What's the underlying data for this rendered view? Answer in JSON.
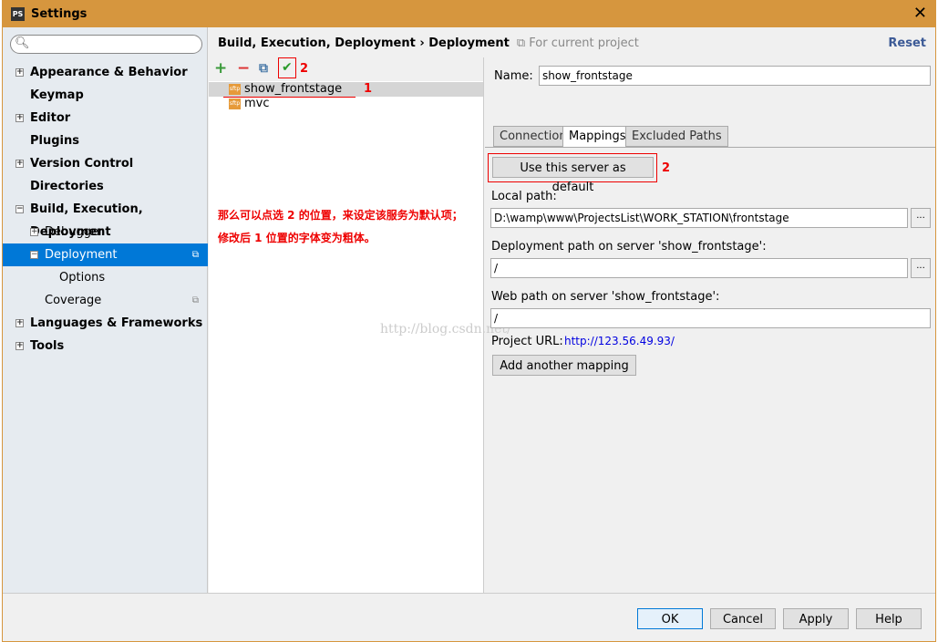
{
  "window": {
    "title": "Settings",
    "logo": "PS"
  },
  "sidebar": {
    "search_placeholder": "",
    "items": [
      {
        "label": "Appearance & Behavior",
        "bold": true,
        "toggle": "+"
      },
      {
        "label": "Keymap",
        "bold": true
      },
      {
        "label": "Editor",
        "bold": true,
        "toggle": "+"
      },
      {
        "label": "Plugins",
        "bold": true
      },
      {
        "label": "Version Control",
        "bold": true,
        "toggle": "+"
      },
      {
        "label": "Directories",
        "bold": true
      },
      {
        "label": "Build, Execution, Deployment",
        "bold": true,
        "toggle": "−"
      },
      {
        "label": "Debugger",
        "toggle": "+"
      },
      {
        "label": "Deployment",
        "toggle": "−",
        "selected": true
      },
      {
        "label": "Options"
      },
      {
        "label": "Coverage"
      },
      {
        "label": "Languages & Frameworks",
        "bold": true,
        "toggle": "+"
      },
      {
        "label": "Tools",
        "bold": true,
        "toggle": "+"
      }
    ]
  },
  "header": {
    "breadcrumb": "Build, Execution, Deployment › Deployment",
    "scope": "For current project",
    "reset": "Reset"
  },
  "servers": [
    {
      "name": "show_frontstage",
      "selected": true
    },
    {
      "name": "mvc"
    }
  ],
  "annotations": {
    "marker1": "1",
    "marker2": "2",
    "note_line1": "那么可以点选 2 的位置，来设定该服务为默认项；",
    "note_line2": "修改后 1 位置的字体变为粗体。",
    "watermark": "http://blog.csdn.net/"
  },
  "details": {
    "name_label": "Name:",
    "name_value": "show_frontstage",
    "tabs": [
      "Connection",
      "Mappings",
      "Excluded Paths"
    ],
    "active_tab": "Mappings",
    "default_button": "Use this server as default",
    "local_path_label": "Local path:",
    "local_path": "D:\\wamp\\www\\ProjectsList\\WORK_STATION\\frontstage",
    "deploy_path_label": "Deployment path on server 'show_frontstage':",
    "deploy_path": "/",
    "web_path_label": "Web path on server 'show_frontstage':",
    "web_path": "/",
    "project_url_label": "Project URL:",
    "project_url": "http://123.56.49.93/",
    "add_mapping": "Add another mapping",
    "browse": "..."
  },
  "footer": {
    "ok": "OK",
    "cancel": "Cancel",
    "apply": "Apply",
    "help": "Help"
  },
  "colors": {
    "titlebar": "#d6963e",
    "selection": "#0078d7",
    "annotation": "#e00000"
  }
}
